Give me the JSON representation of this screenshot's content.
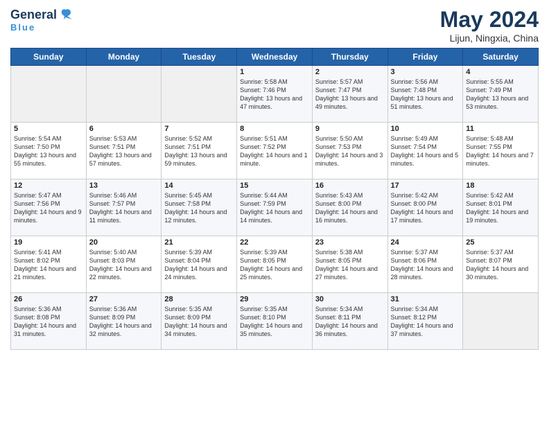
{
  "logo": {
    "general": "General",
    "blue": "Blue",
    "bird_unicode": "🔵"
  },
  "title": "May 2024",
  "subtitle": "Lijun, Ningxia, China",
  "days_header": [
    "Sunday",
    "Monday",
    "Tuesday",
    "Wednesday",
    "Thursday",
    "Friday",
    "Saturday"
  ],
  "weeks": [
    [
      {
        "day": "",
        "sunrise": "",
        "sunset": "",
        "daylight": "",
        "empty": true
      },
      {
        "day": "",
        "sunrise": "",
        "sunset": "",
        "daylight": "",
        "empty": true
      },
      {
        "day": "",
        "sunrise": "",
        "sunset": "",
        "daylight": "",
        "empty": true
      },
      {
        "day": "1",
        "sunrise": "Sunrise: 5:58 AM",
        "sunset": "Sunset: 7:46 PM",
        "daylight": "Daylight: 13 hours and 47 minutes."
      },
      {
        "day": "2",
        "sunrise": "Sunrise: 5:57 AM",
        "sunset": "Sunset: 7:47 PM",
        "daylight": "Daylight: 13 hours and 49 minutes."
      },
      {
        "day": "3",
        "sunrise": "Sunrise: 5:56 AM",
        "sunset": "Sunset: 7:48 PM",
        "daylight": "Daylight: 13 hours and 51 minutes."
      },
      {
        "day": "4",
        "sunrise": "Sunrise: 5:55 AM",
        "sunset": "Sunset: 7:49 PM",
        "daylight": "Daylight: 13 hours and 53 minutes."
      }
    ],
    [
      {
        "day": "5",
        "sunrise": "Sunrise: 5:54 AM",
        "sunset": "Sunset: 7:50 PM",
        "daylight": "Daylight: 13 hours and 55 minutes."
      },
      {
        "day": "6",
        "sunrise": "Sunrise: 5:53 AM",
        "sunset": "Sunset: 7:51 PM",
        "daylight": "Daylight: 13 hours and 57 minutes."
      },
      {
        "day": "7",
        "sunrise": "Sunrise: 5:52 AM",
        "sunset": "Sunset: 7:51 PM",
        "daylight": "Daylight: 13 hours and 59 minutes."
      },
      {
        "day": "8",
        "sunrise": "Sunrise: 5:51 AM",
        "sunset": "Sunset: 7:52 PM",
        "daylight": "Daylight: 14 hours and 1 minute."
      },
      {
        "day": "9",
        "sunrise": "Sunrise: 5:50 AM",
        "sunset": "Sunset: 7:53 PM",
        "daylight": "Daylight: 14 hours and 3 minutes."
      },
      {
        "day": "10",
        "sunrise": "Sunrise: 5:49 AM",
        "sunset": "Sunset: 7:54 PM",
        "daylight": "Daylight: 14 hours and 5 minutes."
      },
      {
        "day": "11",
        "sunrise": "Sunrise: 5:48 AM",
        "sunset": "Sunset: 7:55 PM",
        "daylight": "Daylight: 14 hours and 7 minutes."
      }
    ],
    [
      {
        "day": "12",
        "sunrise": "Sunrise: 5:47 AM",
        "sunset": "Sunset: 7:56 PM",
        "daylight": "Daylight: 14 hours and 9 minutes."
      },
      {
        "day": "13",
        "sunrise": "Sunrise: 5:46 AM",
        "sunset": "Sunset: 7:57 PM",
        "daylight": "Daylight: 14 hours and 11 minutes."
      },
      {
        "day": "14",
        "sunrise": "Sunrise: 5:45 AM",
        "sunset": "Sunset: 7:58 PM",
        "daylight": "Daylight: 14 hours and 12 minutes."
      },
      {
        "day": "15",
        "sunrise": "Sunrise: 5:44 AM",
        "sunset": "Sunset: 7:59 PM",
        "daylight": "Daylight: 14 hours and 14 minutes."
      },
      {
        "day": "16",
        "sunrise": "Sunrise: 5:43 AM",
        "sunset": "Sunset: 8:00 PM",
        "daylight": "Daylight: 14 hours and 16 minutes."
      },
      {
        "day": "17",
        "sunrise": "Sunrise: 5:42 AM",
        "sunset": "Sunset: 8:00 PM",
        "daylight": "Daylight: 14 hours and 17 minutes."
      },
      {
        "day": "18",
        "sunrise": "Sunrise: 5:42 AM",
        "sunset": "Sunset: 8:01 PM",
        "daylight": "Daylight: 14 hours and 19 minutes."
      }
    ],
    [
      {
        "day": "19",
        "sunrise": "Sunrise: 5:41 AM",
        "sunset": "Sunset: 8:02 PM",
        "daylight": "Daylight: 14 hours and 21 minutes."
      },
      {
        "day": "20",
        "sunrise": "Sunrise: 5:40 AM",
        "sunset": "Sunset: 8:03 PM",
        "daylight": "Daylight: 14 hours and 22 minutes."
      },
      {
        "day": "21",
        "sunrise": "Sunrise: 5:39 AM",
        "sunset": "Sunset: 8:04 PM",
        "daylight": "Daylight: 14 hours and 24 minutes."
      },
      {
        "day": "22",
        "sunrise": "Sunrise: 5:39 AM",
        "sunset": "Sunset: 8:05 PM",
        "daylight": "Daylight: 14 hours and 25 minutes."
      },
      {
        "day": "23",
        "sunrise": "Sunrise: 5:38 AM",
        "sunset": "Sunset: 8:05 PM",
        "daylight": "Daylight: 14 hours and 27 minutes."
      },
      {
        "day": "24",
        "sunrise": "Sunrise: 5:37 AM",
        "sunset": "Sunset: 8:06 PM",
        "daylight": "Daylight: 14 hours and 28 minutes."
      },
      {
        "day": "25",
        "sunrise": "Sunrise: 5:37 AM",
        "sunset": "Sunset: 8:07 PM",
        "daylight": "Daylight: 14 hours and 30 minutes."
      }
    ],
    [
      {
        "day": "26",
        "sunrise": "Sunrise: 5:36 AM",
        "sunset": "Sunset: 8:08 PM",
        "daylight": "Daylight: 14 hours and 31 minutes."
      },
      {
        "day": "27",
        "sunrise": "Sunrise: 5:36 AM",
        "sunset": "Sunset: 8:09 PM",
        "daylight": "Daylight: 14 hours and 32 minutes."
      },
      {
        "day": "28",
        "sunrise": "Sunrise: 5:35 AM",
        "sunset": "Sunset: 8:09 PM",
        "daylight": "Daylight: 14 hours and 34 minutes."
      },
      {
        "day": "29",
        "sunrise": "Sunrise: 5:35 AM",
        "sunset": "Sunset: 8:10 PM",
        "daylight": "Daylight: 14 hours and 35 minutes."
      },
      {
        "day": "30",
        "sunrise": "Sunrise: 5:34 AM",
        "sunset": "Sunset: 8:11 PM",
        "daylight": "Daylight: 14 hours and 36 minutes."
      },
      {
        "day": "31",
        "sunrise": "Sunrise: 5:34 AM",
        "sunset": "Sunset: 8:12 PM",
        "daylight": "Daylight: 14 hours and 37 minutes."
      },
      {
        "day": "",
        "sunrise": "",
        "sunset": "",
        "daylight": "",
        "empty": true
      }
    ]
  ]
}
